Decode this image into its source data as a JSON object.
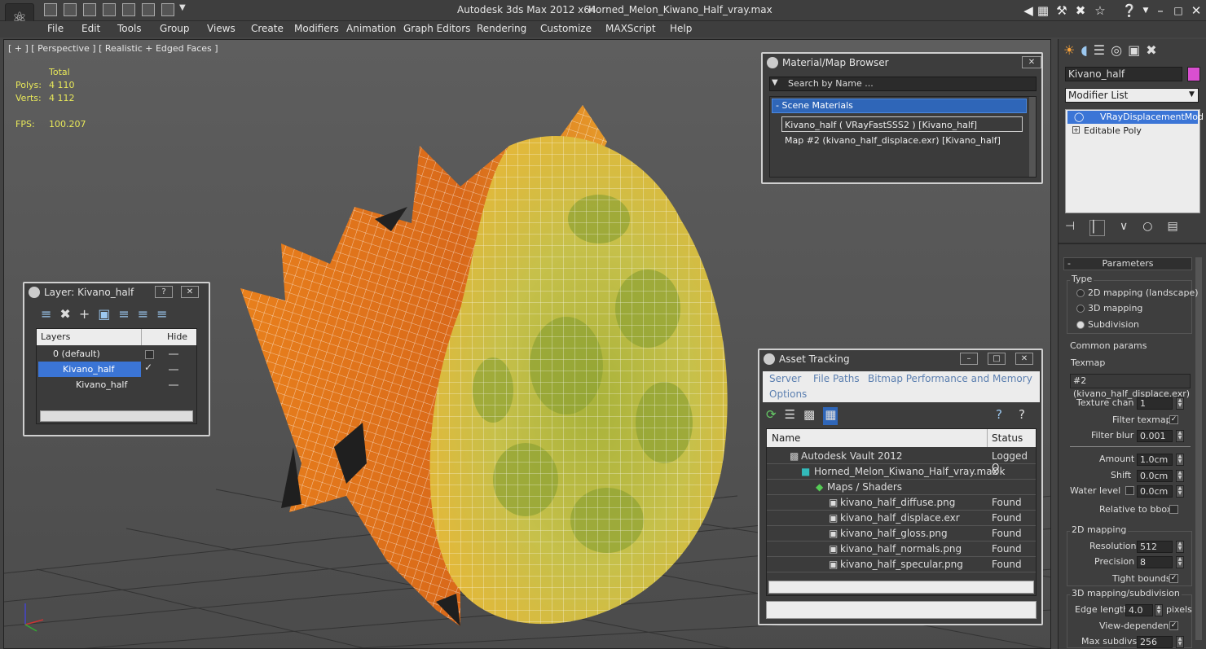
{
  "titlebar": {
    "app": "Autodesk 3ds Max  2012 x64",
    "file": "Horned_Melon_Kiwano_Half_vray.max"
  },
  "menu": [
    "File",
    "Edit",
    "Tools",
    "Group",
    "Views",
    "Create",
    "Modifiers",
    "Animation",
    "Graph Editors",
    "Rendering",
    "Customize",
    "MAXScript",
    "Help"
  ],
  "viewport": {
    "label": "[ + ] [ Perspective ] [ Realistic + Edged Faces ]",
    "stats": {
      "total_label": "Total",
      "polys_label": "Polys:",
      "polys": "4 110",
      "verts_label": "Verts:",
      "verts": "4 112",
      "fps_label": "FPS:",
      "fps": "100.207"
    }
  },
  "material_browser": {
    "title": "Material/Map Browser",
    "search_placeholder": "Search by Name ...",
    "group": "- Scene Materials",
    "items": [
      "Kivano_half  ( VRayFastSSS2 )  [Kivano_half]",
      "Map #2 (kivano_half_displace.exr) [Kivano_half]"
    ]
  },
  "layer_window": {
    "title": "Layer: Kivano_half",
    "col_layers": "Layers",
    "col_hide": "Hide",
    "rows": [
      "0 (default)",
      "Kivano_half",
      "Kivano_half"
    ]
  },
  "asset_tracking": {
    "title": "Asset Tracking",
    "menu": [
      "Server",
      "File",
      "Paths",
      "Bitmap Performance and Memory",
      "Options"
    ],
    "col_name": "Name",
    "col_status": "Status",
    "rows": [
      {
        "name": "Autodesk Vault 2012",
        "status": "Logged O"
      },
      {
        "name": "Horned_Melon_Kiwano_Half_vray.max",
        "status": "Ok"
      },
      {
        "name": "Maps / Shaders",
        "status": ""
      },
      {
        "name": "kivano_half_diffuse.png",
        "status": "Found"
      },
      {
        "name": "kivano_half_displace.exr",
        "status": "Found"
      },
      {
        "name": "kivano_half_gloss.png",
        "status": "Found"
      },
      {
        "name": "kivano_half_normals.png",
        "status": "Found"
      },
      {
        "name": "kivano_half_specular.png",
        "status": "Found"
      }
    ]
  },
  "command_panel": {
    "object_name": "Kivano_half",
    "object_color": "#d94fd0",
    "modifier_list": "Modifier List",
    "stack": [
      "VRayDisplacementMod",
      "Editable Poly"
    ],
    "rollout": "Parameters",
    "type_label": "Type",
    "types": [
      "2D mapping (landscape)",
      "3D mapping",
      "Subdivision"
    ],
    "common_label": "Common params",
    "texmap_label": "Texmap",
    "texmap_value": "#2 (kivano_half_displace.exr)",
    "texture_chan_label": "Texture chan",
    "texture_chan": "1",
    "filter_texmap_label": "Filter texmap",
    "filter_blur_label": "Filter blur",
    "filter_blur": "0.001",
    "amount_label": "Amount",
    "amount": "1.0cm",
    "shift_label": "Shift",
    "shift": "0.0cm",
    "water_label": "Water level",
    "water": "0.0cm",
    "relative_label": "Relative to bbox",
    "map2d_label": "2D mapping",
    "resolution_label": "Resolution",
    "resolution": "512",
    "precision_label": "Precision",
    "precision": "8",
    "tight_label": "Tight bounds",
    "map3d_label": "3D mapping/subdivision",
    "edge_label": "Edge length",
    "edge": "4.0",
    "pixels_label": "pixels",
    "viewdep_label": "View-dependent",
    "maxsub_label": "Max subdivs",
    "maxsub": "256"
  }
}
